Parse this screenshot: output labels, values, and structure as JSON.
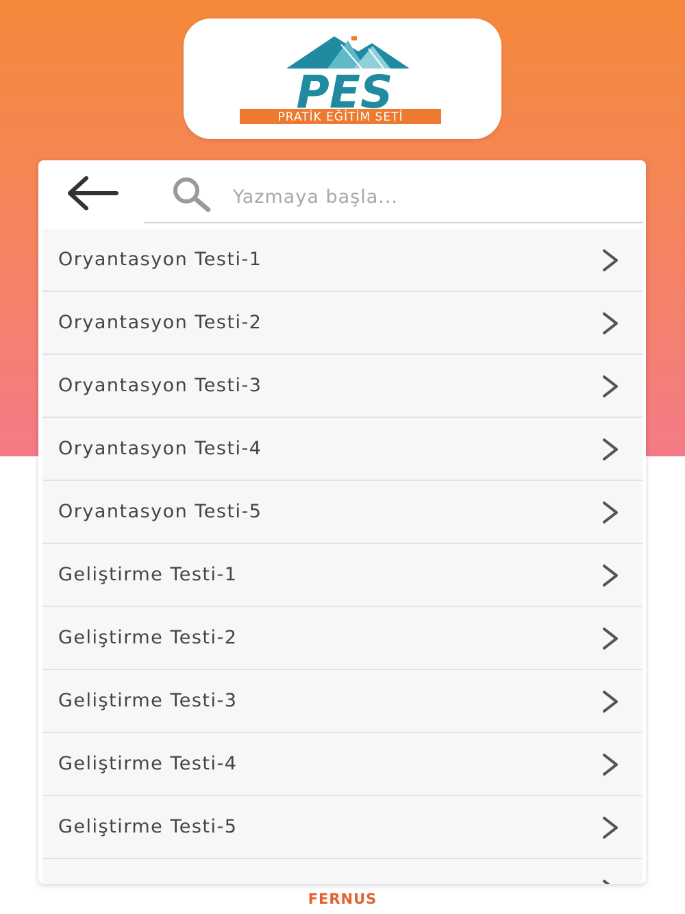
{
  "logo": {
    "wordmark": "PES",
    "tagline": "PRATİK EĞİTİM SETİ",
    "colors": {
      "teal": "#1f8aa0",
      "orange": "#ee7a2f"
    }
  },
  "search": {
    "placeholder": "Yazmaya başla...",
    "value": ""
  },
  "list": {
    "items": [
      {
        "label": "Oryantasyon Testi-1"
      },
      {
        "label": "Oryantasyon Testi-2"
      },
      {
        "label": "Oryantasyon Testi-3"
      },
      {
        "label": "Oryantasyon Testi-4"
      },
      {
        "label": "Oryantasyon Testi-5"
      },
      {
        "label": "Geliştirme Testi-1"
      },
      {
        "label": "Geliştirme Testi-2"
      },
      {
        "label": "Geliştirme Testi-3"
      },
      {
        "label": "Geliştirme Testi-4"
      },
      {
        "label": "Geliştirme Testi-5"
      },
      {
        "label": ""
      }
    ],
    "icon": "chevron-right-icon"
  },
  "footer": {
    "brand": "FERNUS"
  },
  "theme": {
    "gradient_top": "#f4893a",
    "gradient_bottom": "#f47b86",
    "footer_color": "#e2622f"
  }
}
